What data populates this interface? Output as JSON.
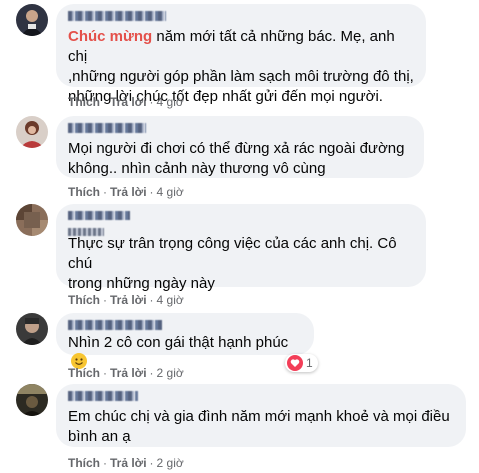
{
  "actions": {
    "like": "Thích",
    "reply": "Trả lời",
    "dot": "·"
  },
  "comments": [
    {
      "highlight": "Chúc mừng",
      "lines": [
        "năm mới tất cả những bác. Mẹ, anh chị",
        ",những người góp phần làm sạch môi trường đô thị,",
        "những lời chúc tốt đẹp nhất gửi đến mọi người."
      ],
      "time": "4 giờ"
    },
    {
      "lines": [
        "Mọi người đi chơi có thể đừng xả rác ngoài đường",
        "không.. nhìn cảnh này thương vô cùng"
      ],
      "time": "4 giờ"
    },
    {
      "lines": [
        "Thực sự trân trọng công việc của các anh chị. Cô chú",
        "trong những ngày này"
      ],
      "time": "4 giờ"
    },
    {
      "lines": [
        "Nhìn 2 cô con gái thật hạnh phúc"
      ],
      "emoji": "smiling-face",
      "reaction_count": "1",
      "time": "2 giờ"
    },
    {
      "lines": [
        "Em chúc chị và gia đình năm mới mạnh khoẻ và mọi điều",
        "bình an ạ"
      ],
      "time": "2 giờ"
    }
  ],
  "colors": {
    "bubble": "#f0f2f5",
    "highlight": "#e4504a",
    "meta": "#65676b",
    "heart": "#f33e58"
  },
  "icons": [
    "heart-icon",
    "smiling-emoji-icon"
  ]
}
